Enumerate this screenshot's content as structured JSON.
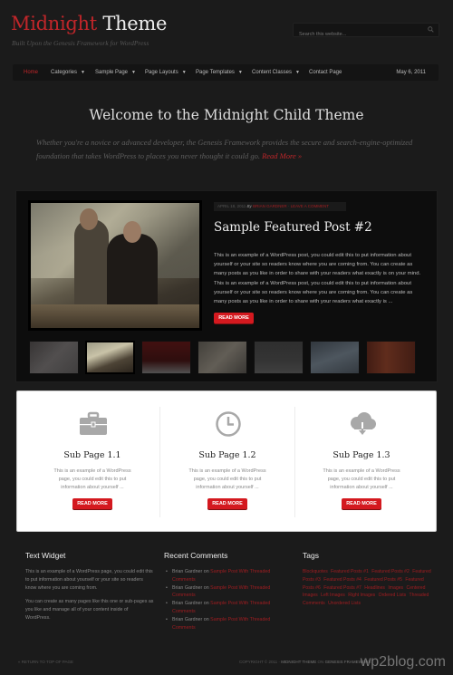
{
  "header": {
    "logo_red": "Midnight",
    "logo_white": "Theme",
    "tagline": "Built Upon the Genesis Framework for WordPress",
    "search_placeholder": "Search this website..."
  },
  "nav": {
    "items": [
      {
        "label": "Home",
        "active": true,
        "dropdown": false
      },
      {
        "label": "Categories",
        "dropdown": true
      },
      {
        "label": "Sample Page",
        "dropdown": true
      },
      {
        "label": "Page Layouts",
        "dropdown": true
      },
      {
        "label": "Page Templates",
        "dropdown": true
      },
      {
        "label": "Content Classes",
        "dropdown": true
      },
      {
        "label": "Contact Page",
        "dropdown": false
      }
    ],
    "caret": "▼",
    "date": "May 6, 2011"
  },
  "welcome": {
    "title": "Welcome to the Midnight Child Theme",
    "text": "Whether you're a novice or advanced developer, the Genesis Framework provides the secure and search-engine-optimized foundation that takes WordPress to places you never thought it could go.",
    "read_more": "Read More »"
  },
  "featured": {
    "meta_date": "APRIL 18, 2011",
    "meta_by": "By",
    "meta_author": "BRIAN GARDNER",
    "meta_sep": "·",
    "meta_comment": "LEAVE A COMMENT",
    "title": "Sample Featured Post #2",
    "excerpt": "This is an example of a WordPress post, you could edit this to put information about yourself or your site so readers know where you are coming from. You can create as many posts as you like in order to share with your readers what exactly is on your mind. This is an example of a WordPress post, you could edit this to put information about yourself or your site so readers know where you are coming from. You can create as many posts as you like in order to share with your readers what exactly is ...",
    "button": "READ MORE",
    "thumbnails": 7,
    "active_thumbnail": 2
  },
  "subpages": [
    {
      "icon": "briefcase-icon",
      "title": "Sub Page 1.1",
      "text": "This is an example of a WordPress page, you could edit this to put information about yourself ...",
      "button": "READ MORE"
    },
    {
      "icon": "clock-icon",
      "title": "Sub Page 1.2",
      "text": "This is an example of a WordPress page, you could edit this to put information about yourself ...",
      "button": "READ MORE"
    },
    {
      "icon": "cloud-download-icon",
      "title": "Sub Page 1.3",
      "text": "This is an example of a WordPress page, you could edit this to put information about yourself ...",
      "button": "READ MORE"
    }
  ],
  "footer_widgets": {
    "text_widget": {
      "title": "Text Widget",
      "paragraph1": "This is an example of a WordPress page, you could edit this to put information about yourself or your site so readers know where you are coming from.",
      "paragraph2": "You can create as many pages like this one or sub-pages as you like and manage all of your content inside of WordPress."
    },
    "recent_comments": {
      "title": "Recent Comments",
      "items": [
        {
          "author": "Brian Gardner",
          "on": "on",
          "post": "Sample Post With Threaded Comments"
        },
        {
          "author": "Brian Gardner",
          "on": "on",
          "post": "Sample Post With Threaded Comments"
        },
        {
          "author": "Brian Gardner",
          "on": "on",
          "post": "Sample Post With Threaded Comments"
        },
        {
          "author": "Brian Gardner",
          "on": "on",
          "post": "Sample Post With Threaded Comments"
        }
      ]
    },
    "tags": {
      "title": "Tags",
      "items": [
        "Blockquotes",
        "Featured Posts #1",
        "Featured Posts #2",
        "Featured Posts #3",
        "Featured Posts #4",
        "Featured Posts #5",
        "Featured Posts #6",
        "Featured Posts #7",
        "Headlines",
        "Images",
        "Centered Images",
        "Left Images",
        "Right Images",
        "Ordered Lists",
        "Threaded Comments",
        "Unordered Lists"
      ]
    }
  },
  "footer": {
    "return_top": "« RETURN TO TOP OF PAGE",
    "copyright_prefix": "COPYRIGHT © 2011 ·",
    "theme_name": "MIDNIGHT THEME",
    "on": "ON",
    "framework": "GENESIS FRAMEWORK",
    "watermark": "wp2blog.com"
  },
  "colors": {
    "accent": "#d4191f",
    "link": "#c0262a",
    "background": "#1b1b1b"
  }
}
